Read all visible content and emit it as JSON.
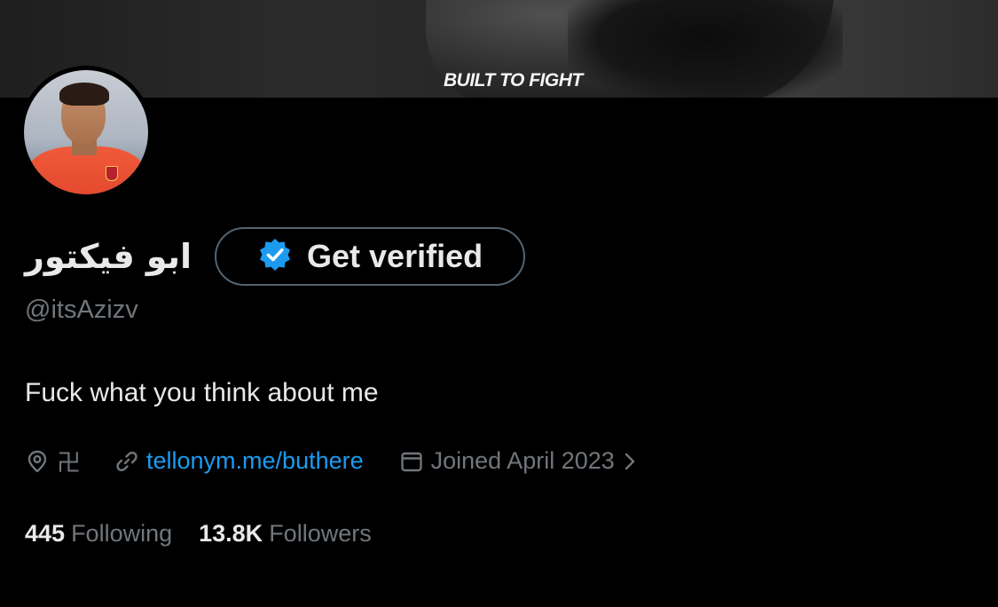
{
  "banner": {
    "text": "BUILT TO FIGHT"
  },
  "profile": {
    "display_name": "ابو فيكتور",
    "handle": "@itsAzizv",
    "bio": "Fuck what you think about me",
    "verify_button_label": "Get verified",
    "location": "卍",
    "link": "tellonym.me/buthere",
    "joined": "Joined April 2023",
    "following_count": "445",
    "following_label": "Following",
    "followers_count": "13.8K",
    "followers_label": "Followers"
  },
  "icons": {
    "verified": "verified-badge-icon",
    "location": "location-pin-icon",
    "link": "link-icon",
    "calendar": "calendar-icon",
    "chevron": "chevron-right-icon"
  },
  "colors": {
    "background": "#000000",
    "text_primary": "#e7e9ea",
    "text_secondary": "#71767b",
    "link": "#1d9bf0",
    "button_border": "#536471",
    "verified_blue": "#1d9bf0"
  }
}
